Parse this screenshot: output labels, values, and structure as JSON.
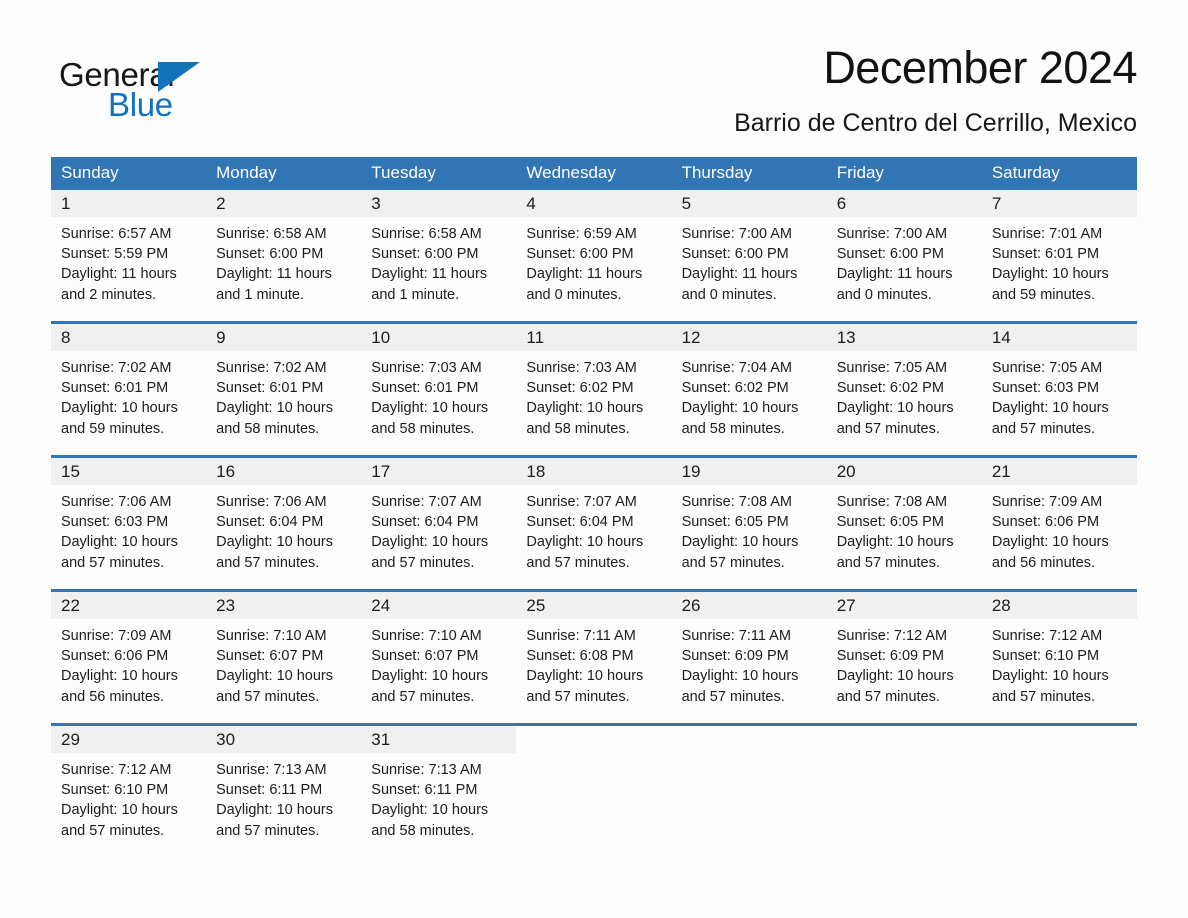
{
  "brand": {
    "name_part1": "General",
    "name_part2": "Blue",
    "accent_color": "#1273b8"
  },
  "header": {
    "title": "December 2024",
    "subtitle": "Barrio de Centro del Cerrillo, Mexico"
  },
  "calendar": {
    "header_bg": "#3175b4",
    "daynum_bg": "#f0f0f0",
    "weekdays": [
      "Sunday",
      "Monday",
      "Tuesday",
      "Wednesday",
      "Thursday",
      "Friday",
      "Saturday"
    ],
    "weeks": [
      [
        {
          "day": "1",
          "sunrise": "Sunrise: 6:57 AM",
          "sunset": "Sunset: 5:59 PM",
          "daylight": "Daylight: 11 hours and 2 minutes."
        },
        {
          "day": "2",
          "sunrise": "Sunrise: 6:58 AM",
          "sunset": "Sunset: 6:00 PM",
          "daylight": "Daylight: 11 hours and 1 minute."
        },
        {
          "day": "3",
          "sunrise": "Sunrise: 6:58 AM",
          "sunset": "Sunset: 6:00 PM",
          "daylight": "Daylight: 11 hours and 1 minute."
        },
        {
          "day": "4",
          "sunrise": "Sunrise: 6:59 AM",
          "sunset": "Sunset: 6:00 PM",
          "daylight": "Daylight: 11 hours and 0 minutes."
        },
        {
          "day": "5",
          "sunrise": "Sunrise: 7:00 AM",
          "sunset": "Sunset: 6:00 PM",
          "daylight": "Daylight: 11 hours and 0 minutes."
        },
        {
          "day": "6",
          "sunrise": "Sunrise: 7:00 AM",
          "sunset": "Sunset: 6:00 PM",
          "daylight": "Daylight: 11 hours and 0 minutes."
        },
        {
          "day": "7",
          "sunrise": "Sunrise: 7:01 AM",
          "sunset": "Sunset: 6:01 PM",
          "daylight": "Daylight: 10 hours and 59 minutes."
        }
      ],
      [
        {
          "day": "8",
          "sunrise": "Sunrise: 7:02 AM",
          "sunset": "Sunset: 6:01 PM",
          "daylight": "Daylight: 10 hours and 59 minutes."
        },
        {
          "day": "9",
          "sunrise": "Sunrise: 7:02 AM",
          "sunset": "Sunset: 6:01 PM",
          "daylight": "Daylight: 10 hours and 58 minutes."
        },
        {
          "day": "10",
          "sunrise": "Sunrise: 7:03 AM",
          "sunset": "Sunset: 6:01 PM",
          "daylight": "Daylight: 10 hours and 58 minutes."
        },
        {
          "day": "11",
          "sunrise": "Sunrise: 7:03 AM",
          "sunset": "Sunset: 6:02 PM",
          "daylight": "Daylight: 10 hours and 58 minutes."
        },
        {
          "day": "12",
          "sunrise": "Sunrise: 7:04 AM",
          "sunset": "Sunset: 6:02 PM",
          "daylight": "Daylight: 10 hours and 58 minutes."
        },
        {
          "day": "13",
          "sunrise": "Sunrise: 7:05 AM",
          "sunset": "Sunset: 6:02 PM",
          "daylight": "Daylight: 10 hours and 57 minutes."
        },
        {
          "day": "14",
          "sunrise": "Sunrise: 7:05 AM",
          "sunset": "Sunset: 6:03 PM",
          "daylight": "Daylight: 10 hours and 57 minutes."
        }
      ],
      [
        {
          "day": "15",
          "sunrise": "Sunrise: 7:06 AM",
          "sunset": "Sunset: 6:03 PM",
          "daylight": "Daylight: 10 hours and 57 minutes."
        },
        {
          "day": "16",
          "sunrise": "Sunrise: 7:06 AM",
          "sunset": "Sunset: 6:04 PM",
          "daylight": "Daylight: 10 hours and 57 minutes."
        },
        {
          "day": "17",
          "sunrise": "Sunrise: 7:07 AM",
          "sunset": "Sunset: 6:04 PM",
          "daylight": "Daylight: 10 hours and 57 minutes."
        },
        {
          "day": "18",
          "sunrise": "Sunrise: 7:07 AM",
          "sunset": "Sunset: 6:04 PM",
          "daylight": "Daylight: 10 hours and 57 minutes."
        },
        {
          "day": "19",
          "sunrise": "Sunrise: 7:08 AM",
          "sunset": "Sunset: 6:05 PM",
          "daylight": "Daylight: 10 hours and 57 minutes."
        },
        {
          "day": "20",
          "sunrise": "Sunrise: 7:08 AM",
          "sunset": "Sunset: 6:05 PM",
          "daylight": "Daylight: 10 hours and 57 minutes."
        },
        {
          "day": "21",
          "sunrise": "Sunrise: 7:09 AM",
          "sunset": "Sunset: 6:06 PM",
          "daylight": "Daylight: 10 hours and 56 minutes."
        }
      ],
      [
        {
          "day": "22",
          "sunrise": "Sunrise: 7:09 AM",
          "sunset": "Sunset: 6:06 PM",
          "daylight": "Daylight: 10 hours and 56 minutes."
        },
        {
          "day": "23",
          "sunrise": "Sunrise: 7:10 AM",
          "sunset": "Sunset: 6:07 PM",
          "daylight": "Daylight: 10 hours and 57 minutes."
        },
        {
          "day": "24",
          "sunrise": "Sunrise: 7:10 AM",
          "sunset": "Sunset: 6:07 PM",
          "daylight": "Daylight: 10 hours and 57 minutes."
        },
        {
          "day": "25",
          "sunrise": "Sunrise: 7:11 AM",
          "sunset": "Sunset: 6:08 PM",
          "daylight": "Daylight: 10 hours and 57 minutes."
        },
        {
          "day": "26",
          "sunrise": "Sunrise: 7:11 AM",
          "sunset": "Sunset: 6:09 PM",
          "daylight": "Daylight: 10 hours and 57 minutes."
        },
        {
          "day": "27",
          "sunrise": "Sunrise: 7:12 AM",
          "sunset": "Sunset: 6:09 PM",
          "daylight": "Daylight: 10 hours and 57 minutes."
        },
        {
          "day": "28",
          "sunrise": "Sunrise: 7:12 AM",
          "sunset": "Sunset: 6:10 PM",
          "daylight": "Daylight: 10 hours and 57 minutes."
        }
      ],
      [
        {
          "day": "29",
          "sunrise": "Sunrise: 7:12 AM",
          "sunset": "Sunset: 6:10 PM",
          "daylight": "Daylight: 10 hours and 57 minutes."
        },
        {
          "day": "30",
          "sunrise": "Sunrise: 7:13 AM",
          "sunset": "Sunset: 6:11 PM",
          "daylight": "Daylight: 10 hours and 57 minutes."
        },
        {
          "day": "31",
          "sunrise": "Sunrise: 7:13 AM",
          "sunset": "Sunset: 6:11 PM",
          "daylight": "Daylight: 10 hours and 58 minutes."
        },
        {
          "day": "",
          "sunrise": "",
          "sunset": "",
          "daylight": ""
        },
        {
          "day": "",
          "sunrise": "",
          "sunset": "",
          "daylight": ""
        },
        {
          "day": "",
          "sunrise": "",
          "sunset": "",
          "daylight": ""
        },
        {
          "day": "",
          "sunrise": "",
          "sunset": "",
          "daylight": ""
        }
      ]
    ]
  }
}
